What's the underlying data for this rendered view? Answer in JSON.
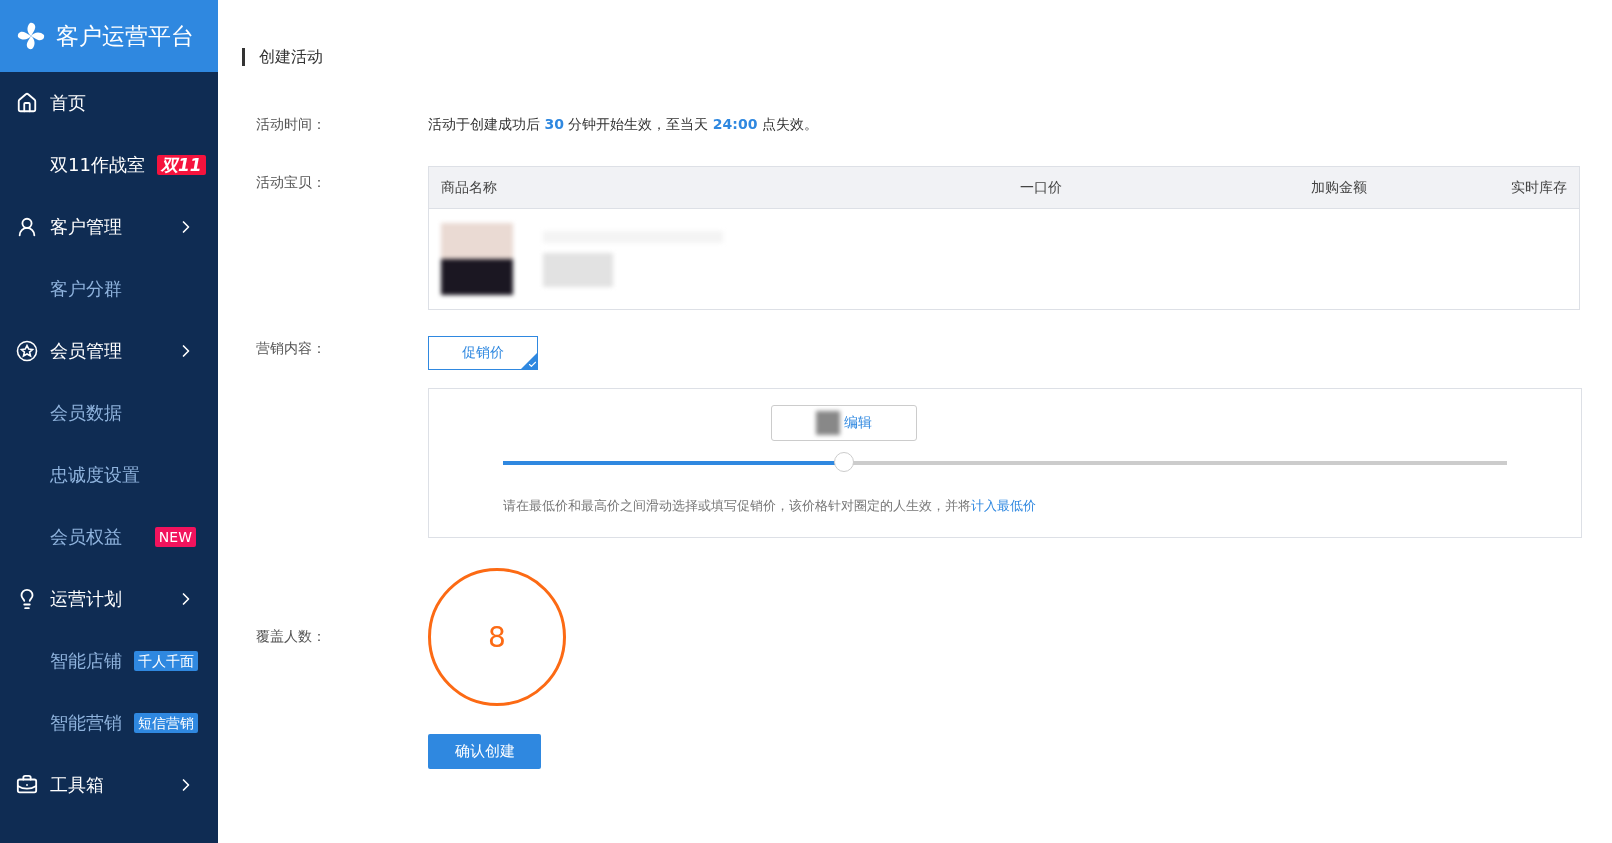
{
  "sidebar": {
    "title": "客户运营平台",
    "items": [
      {
        "kind": "main",
        "label": "首页",
        "expandable": false
      },
      {
        "kind": "feature",
        "label": "双11作战室",
        "badge": {
          "text": "双11",
          "color": "#f5133d",
          "italic": true
        }
      },
      {
        "kind": "main",
        "label": "客户管理",
        "expandable": true
      },
      {
        "kind": "sub",
        "label": "客户分群"
      },
      {
        "kind": "main",
        "label": "会员管理",
        "expandable": true
      },
      {
        "kind": "sub",
        "label": "会员数据"
      },
      {
        "kind": "sub",
        "label": "忠诚度设置"
      },
      {
        "kind": "sub",
        "label": "会员权益",
        "badge": {
          "text": "NEW",
          "color": "#f2135d",
          "italic": false
        }
      },
      {
        "kind": "main",
        "label": "运营计划",
        "expandable": true
      },
      {
        "kind": "sub",
        "label": "智能店铺",
        "badge": {
          "text": "千人千面",
          "color": "#2f88e0",
          "italic": false
        }
      },
      {
        "kind": "sub",
        "label": "智能营销",
        "badge": {
          "text": "短信营销",
          "color": "#2f88e0",
          "italic": false
        }
      },
      {
        "kind": "main",
        "label": "工具箱",
        "expandable": true
      }
    ]
  },
  "page": {
    "title": "创建活动",
    "time": {
      "label": "活动时间：",
      "text": "活动于创建成功后 **30** 分钟开始生效，至当天 **24:00** 点失效。"
    },
    "items": {
      "label": "活动宝贝：",
      "columns": [
        "商品名称",
        "一口价",
        "加购金额",
        "实时库存"
      ]
    },
    "marketing": {
      "label": "营销内容：",
      "options": [
        {
          "label": "促销价",
          "selected": true
        }
      ],
      "tooltip": "编辑",
      "level": 0.34,
      "hint": "请在最低价和最高价之间滑动选择或填写促销价，该价格针对圈定的人生效，并将",
      "hint_link": "计入最低价"
    },
    "coverage": {
      "label": "覆盖人数：",
      "value": "8"
    },
    "submit": "确认创建"
  }
}
